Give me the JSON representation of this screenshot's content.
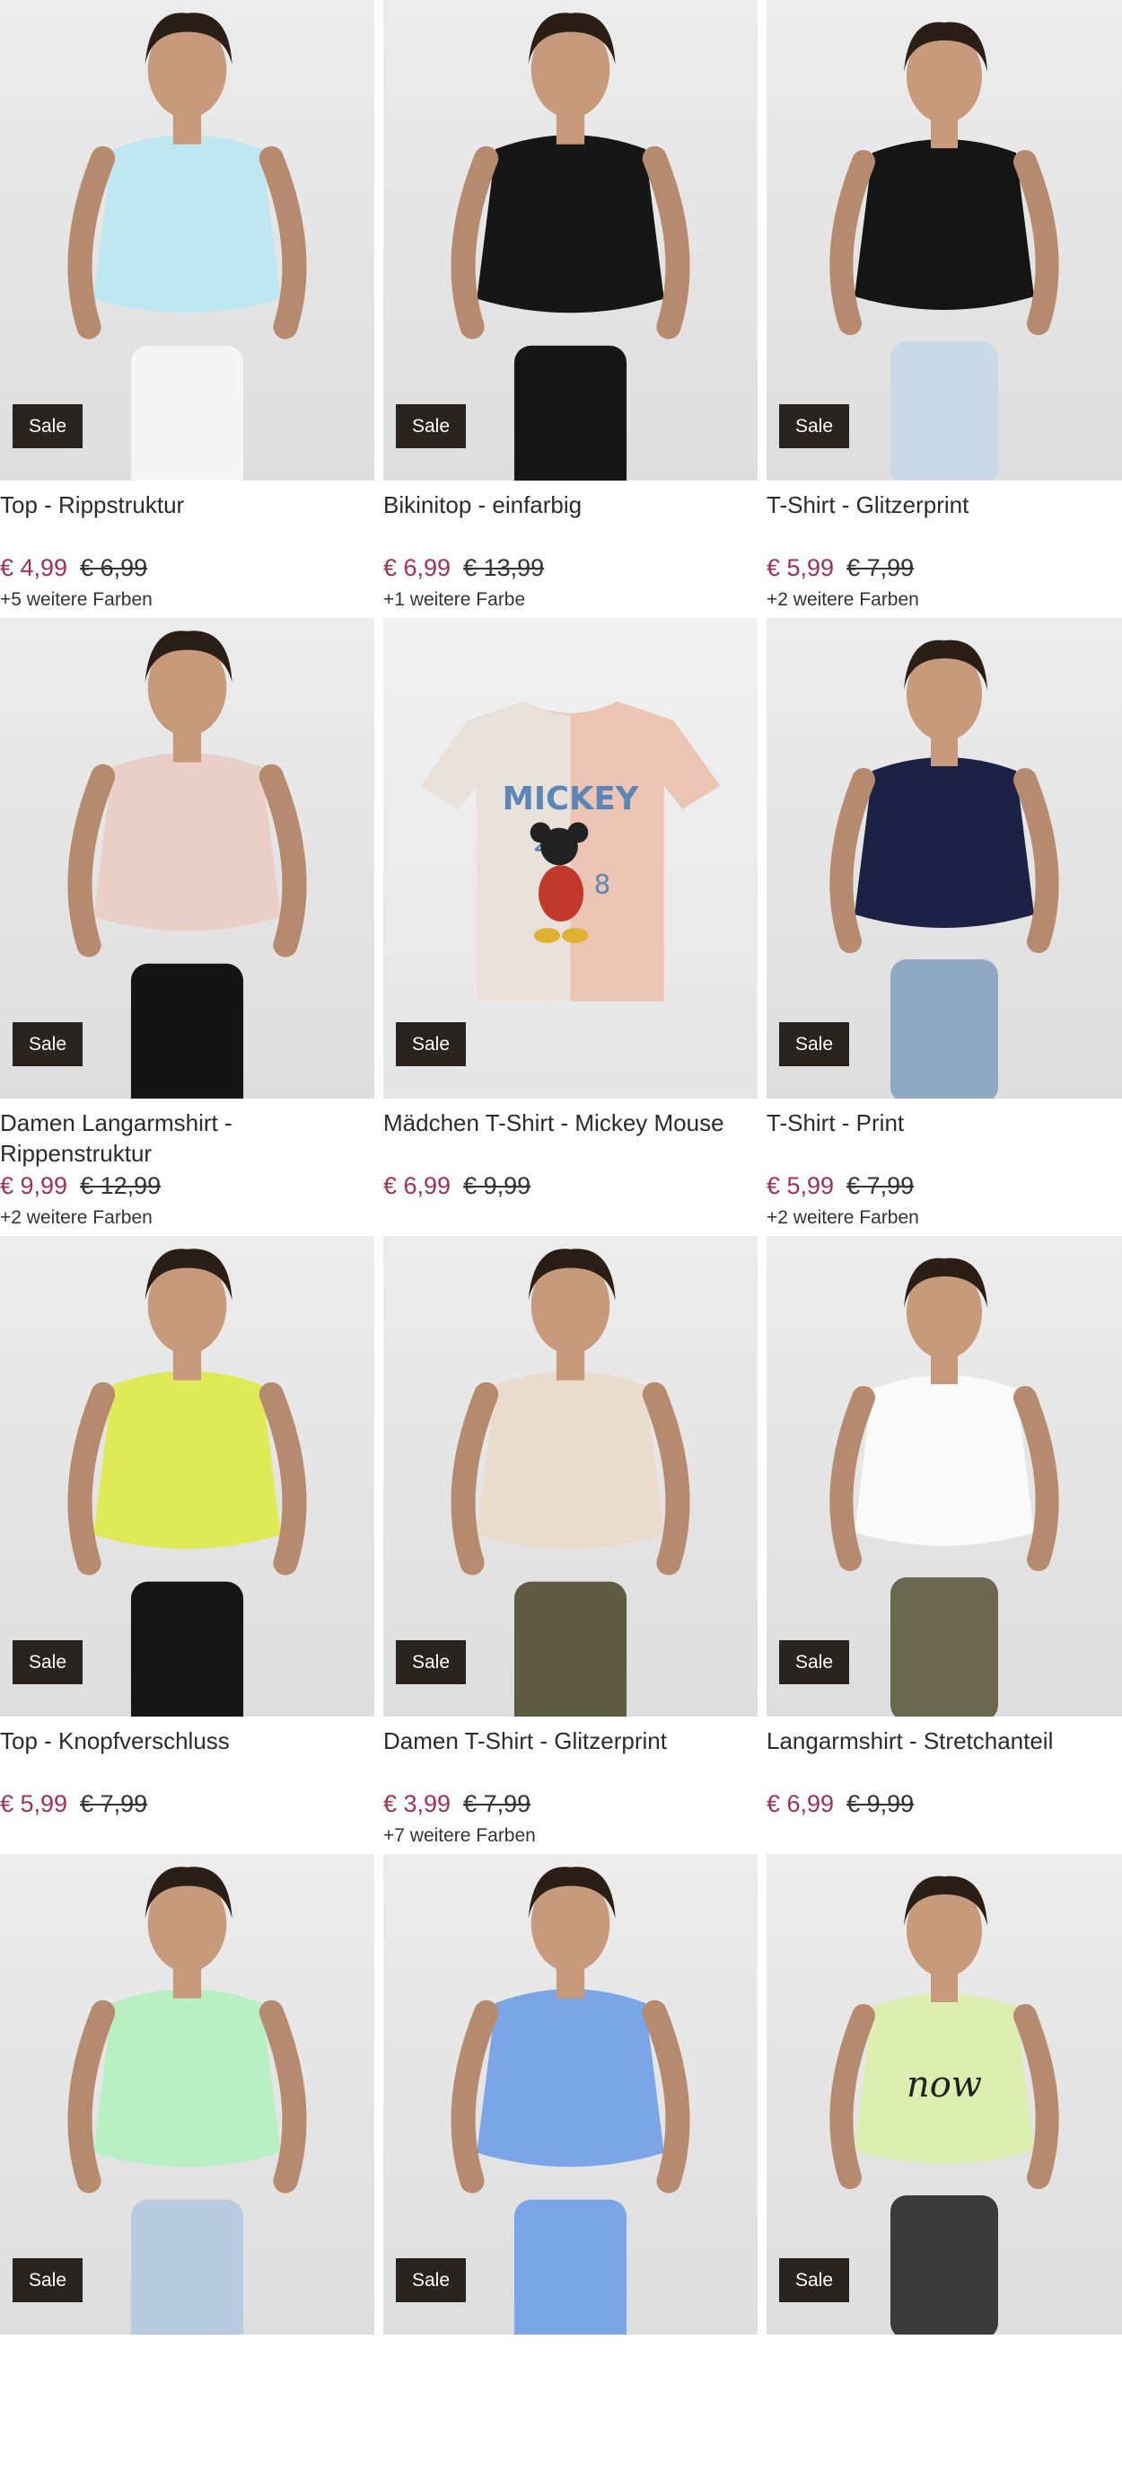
{
  "products": [
    {
      "title": "Top - Rippstruktur",
      "price": "€ 4,99",
      "old_price": "€ 6,99",
      "colors": "+5 weitere Farben",
      "badge": "Sale",
      "garment_color": "#bfe7f2",
      "bottom_color": "#f5f5f5"
    },
    {
      "title": "Bikinitop - einfarbig",
      "price": "€ 6,99",
      "old_price": "€ 13,99",
      "colors": "+1 weitere Farbe",
      "badge": "Sale",
      "garment_color": "#161616",
      "bottom_color": "#161616"
    },
    {
      "title": "T-Shirt - Glitzerprint",
      "price": "€ 5,99",
      "old_price": "€ 7,99",
      "colors": "+2 weitere Farben",
      "badge": "Sale",
      "garment_color": "#151515",
      "bottom_color": "#c9d9e8"
    },
    {
      "title": "Damen Langarmshirt - Rippenstruktur",
      "price": "€ 9,99",
      "old_price": "€ 12,99",
      "colors": "+2 weitere Farben",
      "badge": "Sale",
      "garment_color": "#e9cfc8",
      "bottom_color": "#141414"
    },
    {
      "title": "Mädchen T-Shirt - Mickey Mouse",
      "price": "€ 6,99",
      "old_price": "€ 9,99",
      "colors": "",
      "badge": "Sale",
      "garment_color": "#ecc4b4",
      "bottom_color": "#e8e2da"
    },
    {
      "title": "T-Shirt - Print",
      "price": "€ 5,99",
      "old_price": "€ 7,99",
      "colors": "+2 weitere Farben",
      "badge": "Sale",
      "garment_color": "#1c2246",
      "bottom_color": "#8fa9c4"
    },
    {
      "title": "Top - Knopfverschluss",
      "price": "€ 5,99",
      "old_price": "€ 7,99",
      "colors": "",
      "badge": "Sale",
      "garment_color": "#dfea57",
      "bottom_color": "#151515"
    },
    {
      "title": "Damen T-Shirt - Glitzerprint",
      "price": "€ 3,99",
      "old_price": "€ 7,99",
      "colors": "+7 weitere Farben",
      "badge": "Sale",
      "garment_color": "#e9dccd",
      "bottom_color": "#5f5b43"
    },
    {
      "title": "Langarmshirt - Stretchanteil",
      "price": "€ 6,99",
      "old_price": "€ 9,99",
      "colors": "",
      "badge": "Sale",
      "garment_color": "#fafafa",
      "bottom_color": "#6a6750"
    },
    {
      "title": "",
      "price": "",
      "old_price": "",
      "colors": "",
      "badge": "Sale",
      "garment_color": "#b8efc3",
      "bottom_color": "#b9cbe0"
    },
    {
      "title": "",
      "price": "",
      "old_price": "",
      "colors": "",
      "badge": "Sale",
      "garment_color": "#7aa5e6",
      "bottom_color": "#7aa5e6"
    },
    {
      "title": "",
      "price": "",
      "old_price": "",
      "colors": "",
      "badge": "Sale",
      "garment_color": "#dcefb0",
      "bottom_color": "#3a3a3a"
    }
  ],
  "mickey_print": {
    "word": "MICKEY",
    "num_a": "2",
    "num_b": "8"
  },
  "sweater_print": {
    "word": "now"
  }
}
